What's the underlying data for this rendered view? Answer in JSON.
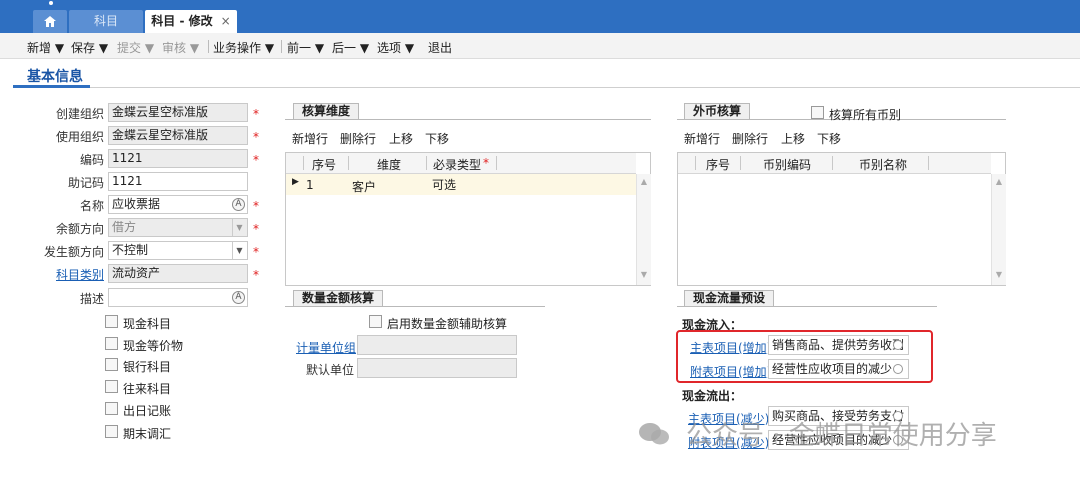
{
  "tabs": {
    "home_icon": "home-icon",
    "tab1": "科目",
    "tab2": "科目 - 修改",
    "close": "×"
  },
  "toolbar": {
    "new": "新增 ▼",
    "save": "保存 ▼",
    "submit": "提交 ▼",
    "audit": "审核 ▼",
    "business": "业务操作 ▼",
    "prev": "前一 ▼",
    "next": "后一 ▼",
    "options": "选项 ▼",
    "exit": "退出"
  },
  "section_title": "基本信息",
  "form": {
    "create_org": {
      "label": "创建组织",
      "value": "金蝶云星空标准版"
    },
    "use_org": {
      "label": "使用组织",
      "value": "金蝶云星空标准版"
    },
    "code": {
      "label": "编码",
      "value": "1121"
    },
    "mnemonic": {
      "label": "助记码",
      "value": "1121"
    },
    "name": {
      "label": "名称",
      "value": "应收票据"
    },
    "balance_dir": {
      "label": "余额方向",
      "value": "借方"
    },
    "occur_dir": {
      "label": "发生额方向",
      "value": "不控制"
    },
    "category": {
      "label": "科目类别",
      "value": "流动资产"
    },
    "desc": {
      "label": "描述",
      "value": ""
    },
    "required_mark": "*"
  },
  "checkboxes": [
    "现金科目",
    "现金等价物",
    "银行科目",
    "往来科目",
    "出日记账",
    "期末调汇"
  ],
  "dimension": {
    "title": "核算维度",
    "tools": [
      "新增行",
      "删除行",
      "上移",
      "下移"
    ],
    "columns": [
      "序号",
      "维度",
      "必录类型"
    ],
    "required_star": "*",
    "rows": [
      {
        "seq": "1",
        "dim": "客户",
        "type": "可选"
      }
    ]
  },
  "currency": {
    "title": "外币核算",
    "all_label": "核算所有币别",
    "tools": [
      "新增行",
      "删除行",
      "上移",
      "下移"
    ],
    "columns": [
      "序号",
      "币别编码",
      "币别名称"
    ]
  },
  "quantity": {
    "title": "数量金额核算",
    "enable_label": "启用数量金额辅助核算",
    "unit_group": "计量单位组",
    "default_unit": "默认单位"
  },
  "cashflow": {
    "title": "现金流量预设",
    "inflow": "现金流入：",
    "outflow": "现金流出：",
    "in_main_label": "主表项目(增加)",
    "in_main_value": "销售商品、提供劳务收到",
    "in_sub_label": "附表项目(增加)",
    "in_sub_value": "经营性应收项目的减少",
    "out_main_label": "主表项目(减少)",
    "out_main_value": "购买商品、接受劳务支付",
    "out_sub_label": "附表项目(减少)",
    "out_sub_value": "经营性应收项目的减少"
  },
  "watermark": "公众号 · 金蝶日常使用分享"
}
